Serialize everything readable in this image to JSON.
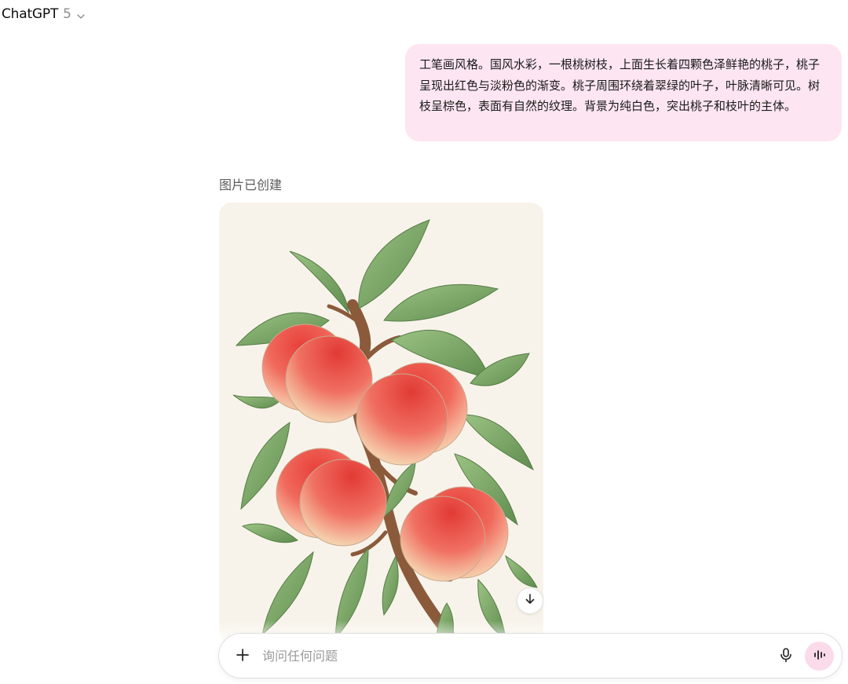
{
  "header": {
    "model_name": "ChatGPT",
    "model_version": "5",
    "dropdown_icon": "chevron-down-icon"
  },
  "conversation": {
    "user_message": "工笔画风格。国风水彩，一根桃树枝，上面生长着四颗色泽鲜艳的桃子，桃子呈现出红色与淡粉色的渐变。桃子周围环绕着翠绿的叶子，叶脉清晰可见。树枝呈棕色，表面有自然的纹理。背景为纯白色，突出桃子和枝叶的主体。",
    "assistant_status": "图片已创建",
    "image_download_icon": "arrow-down-icon"
  },
  "composer": {
    "placeholder": "询问任何问题",
    "value": "",
    "add_icon": "plus-icon",
    "mic_icon": "microphone-icon",
    "voice_icon": "voice-waveform-icon"
  },
  "colors": {
    "user_bubble": "#fde6f1",
    "voice_button": "#fbdbe9",
    "image_background": "#f8f3ea",
    "peach_red": "#e8403a",
    "peach_cream": "#f3e3b4",
    "leaf_green": "#7ea968",
    "branch_brown": "#8a5a3b"
  }
}
